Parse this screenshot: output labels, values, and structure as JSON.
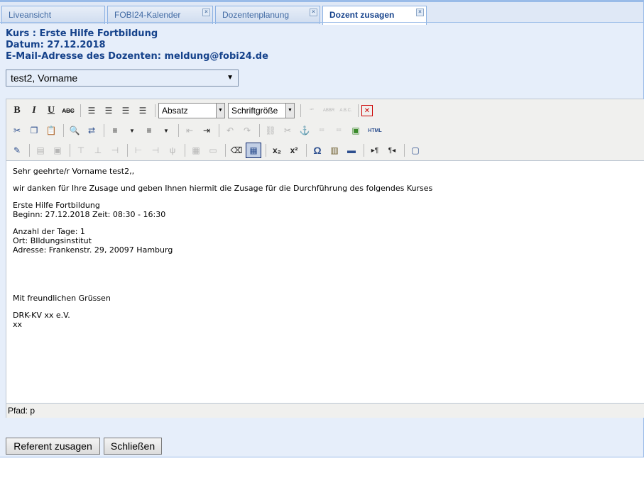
{
  "tabs": [
    {
      "label": "Liveansicht",
      "closable": false,
      "active": false
    },
    {
      "label": "FOBI24-Kalender",
      "closable": true,
      "active": false
    },
    {
      "label": "Dozentenplanung",
      "closable": true,
      "active": false
    },
    {
      "label": "Dozent zusagen",
      "closable": true,
      "active": true
    }
  ],
  "info": {
    "course": "Kurs : Erste Hilfe Fortbildung",
    "date": "Datum: 27.12.2018",
    "email": "E-Mail-Adresse des Dozenten: meldung@fobi24.de"
  },
  "lecturer_select": {
    "value": "test2, Vorname"
  },
  "toolbar": {
    "format_dropdown": "Absatz",
    "fontsize_dropdown": "Schriftgröße",
    "html_label": "HTML"
  },
  "letter": {
    "salutation": "Sehr geehrte/r Vorname test2,,",
    "intro": "wir danken für Ihre Zusage und geben Ihnen hiermit die Zusage für die Durchführung des folgendes Kurses",
    "course_name": "Erste Hilfe Fortbildung",
    "course_time": "Beginn: 27.12.2018 Zeit: 08:30 - 16:30",
    "days": "Anzahl der Tage: 1",
    "location": "Ort: BIldungsinstitut",
    "address": "Adresse: Frankenstr. 29, 20097 Hamburg",
    "closing": "Mit freundlichen Grüssen",
    "org": "DRK-KV xx e.V.",
    "signature": "xx"
  },
  "path_bar": "Pfad: p",
  "buttons": {
    "confirm": "Referent zusagen",
    "close": "Schließen"
  }
}
